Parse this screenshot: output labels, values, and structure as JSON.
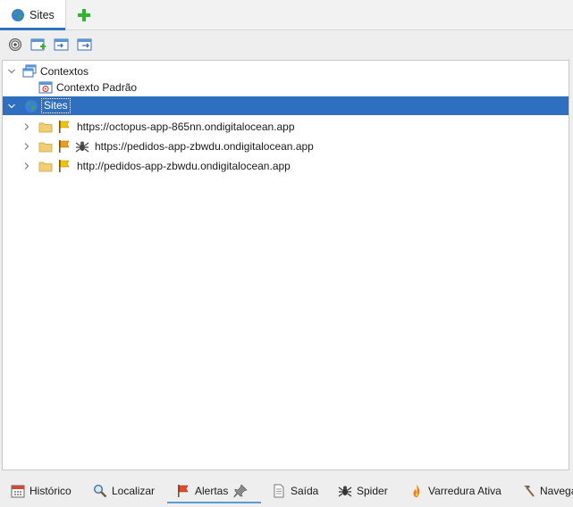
{
  "top_tabs": {
    "sites_label": "Sites",
    "add_icon": "plus-icon"
  },
  "toolbar": {
    "buttons": [
      "target-icon",
      "new-context-icon",
      "import-context-icon",
      "export-context-icon"
    ]
  },
  "tree": {
    "contexts_label": "Contextos",
    "default_context_label": "Contexto Padrão",
    "sites_label": "Sites",
    "site_nodes": [
      {
        "label": "https://octopus-app-865nn.ondigitalocean.app",
        "flag_color": "#f2c300"
      },
      {
        "label": "https://pedidos-app-zbwdu.ondigitalocean.app",
        "flag_color": "#f09a1a"
      },
      {
        "label": "http://pedidos-app-zbwdu.ondigitalocean.app",
        "flag_color": "#f2c300"
      }
    ]
  },
  "bottom_tabs": [
    {
      "label": "Histórico",
      "icon": "calendar-icon"
    },
    {
      "label": "Localizar",
      "icon": "magnifier-icon"
    },
    {
      "label": "Alertas",
      "icon": "flag-icon",
      "active": true
    },
    {
      "label": "Saída",
      "icon": "document-icon"
    },
    {
      "label": "Spider",
      "icon": "spider-icon"
    },
    {
      "label": "Varredura Ativa",
      "icon": "flame-icon"
    },
    {
      "label": "Navega",
      "icon": "hammer-icon"
    }
  ],
  "colors": {
    "selection": "#2f6fbf",
    "active_tab_underline": "#2a74bd",
    "folder": "#f0cf74"
  }
}
